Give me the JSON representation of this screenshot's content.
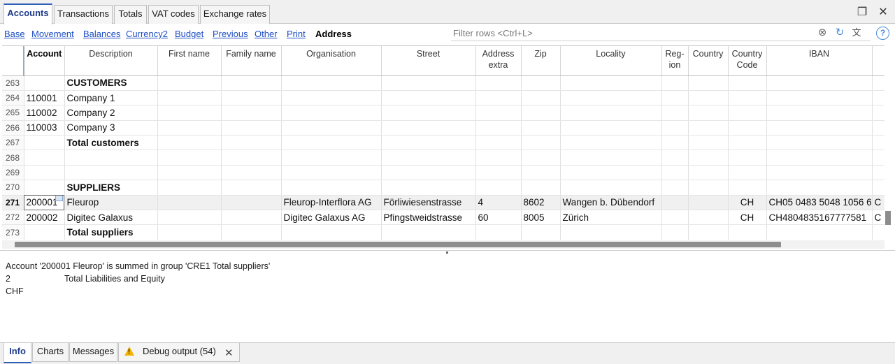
{
  "top_tabs": [
    "Accounts",
    "Transactions",
    "Totals",
    "VAT codes",
    "Exchange rates"
  ],
  "active_top_tab": "Accounts",
  "column_sets": [
    "Base",
    "Movement",
    "Balances",
    "Currency2",
    "Budget",
    "Previous",
    "Other",
    "Print",
    "Address"
  ],
  "active_column_set": "Address",
  "filter": {
    "placeholder": "Filter rows <Ctrl+L>",
    "value": ""
  },
  "columns": [
    "",
    "Account",
    "Description",
    "First name",
    "Family name",
    "Organisation",
    "Street",
    "Address extra",
    "Zip",
    "Locality",
    "Reg-ion",
    "Country",
    "Country Code",
    "IBAN"
  ],
  "columns_display": {
    "address_extra": [
      "Address",
      "extra"
    ],
    "region": [
      "Reg-",
      "ion"
    ],
    "country_code": [
      "Country",
      "Code"
    ]
  },
  "rows": [
    {
      "n": "263",
      "account": "",
      "description": "CUSTOMERS",
      "bold": true
    },
    {
      "n": "264",
      "account": "110001",
      "description": "Company 1"
    },
    {
      "n": "265",
      "account": "110002",
      "description": "Company 2"
    },
    {
      "n": "266",
      "account": "110003",
      "description": "Company 3"
    },
    {
      "n": "267",
      "account": "",
      "description": "Total customers",
      "bold": true
    },
    {
      "n": "268",
      "account": "",
      "description": ""
    },
    {
      "n": "269",
      "account": "",
      "description": ""
    },
    {
      "n": "270",
      "account": "",
      "description": "SUPPLIERS",
      "bold": true
    },
    {
      "n": "271",
      "account": "200001",
      "description": "Fleurop",
      "organisation": "Fleurop-Interflora AG",
      "street": "Förliwiesenstrasse",
      "address_extra": "4",
      "zip": "8602",
      "locality": "Wangen b. Dübendorf",
      "country_code": "CH",
      "iban": "CH05 0483 5048 1056 6",
      "tail": "C",
      "current": true
    },
    {
      "n": "272",
      "account": "200002",
      "description": "Digitec Galaxus",
      "organisation": "Digitec Galaxus AG",
      "street": "Pfingstweidstrasse",
      "address_extra": "60",
      "zip": "8005",
      "locality": "Zürich",
      "country_code": "CH",
      "iban": "CH4804835167777581",
      "tail": "C"
    },
    {
      "n": "273",
      "account": "",
      "description": "Total suppliers",
      "bold": true
    }
  ],
  "info": {
    "message": "Account '200001 Fleurop' is summed in group 'CRE1 Total suppliers'",
    "group_code": "2",
    "group_name": "Total Liabilities and Equity",
    "currency": "CHF"
  },
  "bottom_tabs": [
    "Info",
    "Charts",
    "Messages",
    "Debug output (54)"
  ],
  "active_bottom_tab": "Info"
}
